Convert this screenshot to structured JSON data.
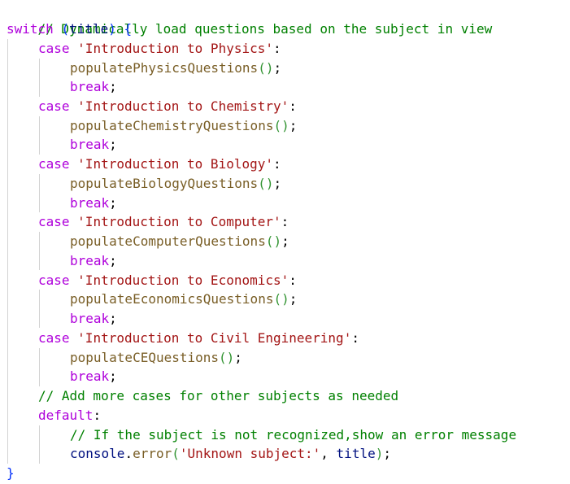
{
  "code": {
    "comment_top": "// Dynamically load questions based on the subject in view",
    "switch_kw": "switch",
    "switch_arg": "title",
    "case_kw": "case",
    "break_kw": "break",
    "default_kw": "default",
    "cases": [
      {
        "label": "'Introduction to Physics'",
        "call": "populatePhysicsQuestions"
      },
      {
        "label": "'Introduction to Chemistry'",
        "call": "populateChemistryQuestions"
      },
      {
        "label": "'Introduction to Biology'",
        "call": "populateBiologyQuestions"
      },
      {
        "label": "'Introduction to Computer'",
        "call": "populateComputerQuestions"
      },
      {
        "label": "'Introduction to Economics'",
        "call": "populateEconomicsQuestions"
      },
      {
        "label": "'Introduction to Civil Engineering'",
        "call": "populateCEQuestions"
      }
    ],
    "comment_more": "// Add more cases for other subjects as needed",
    "comment_default": "// If the subject is not recognized,show an error message",
    "console_obj": "console",
    "console_method": "error",
    "error_string": "'Unknown subject:'",
    "error_arg": "title"
  }
}
